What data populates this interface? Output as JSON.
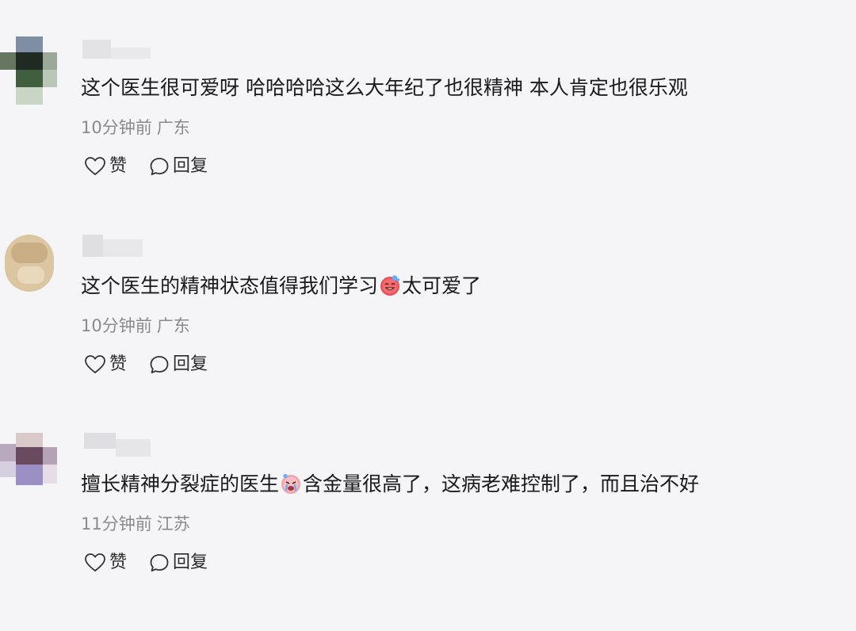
{
  "comments": [
    {
      "text": "这个医生很可爱呀 哈哈哈哈这么大年纪了也很精神 本人肯定也很乐观",
      "text_after_emoji": "",
      "emoji": null,
      "time": "10分钟前",
      "location": "广东",
      "like_label": "赞",
      "reply_label": "回复"
    },
    {
      "text": "这个医生的精神状态值得我们学习",
      "emoji": "laughing-crying-emoji",
      "text_after_emoji": "太可爱了",
      "time": "10分钟前",
      "location": "广东",
      "like_label": "赞",
      "reply_label": "回复"
    },
    {
      "text": "擅长精神分裂症的医生",
      "emoji": "crying-emoji",
      "text_after_emoji": "含金量很高了，这病老难控制了，而且治不好",
      "time": "11分钟前",
      "location": "江苏",
      "like_label": "赞",
      "reply_label": "回复"
    }
  ]
}
